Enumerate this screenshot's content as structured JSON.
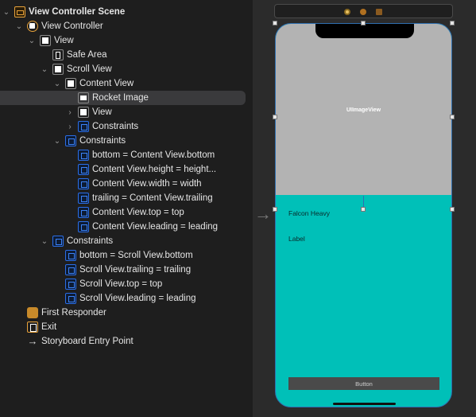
{
  "outline": {
    "items": [
      {
        "label": "View Controller Scene",
        "icon": "scene-icon",
        "expanded": true,
        "level": 0,
        "bold": true
      },
      {
        "label": "View Controller",
        "icon": "view-controller-icon",
        "expanded": true,
        "level": 1
      },
      {
        "label": "View",
        "icon": "view-icon",
        "expanded": true,
        "level": 2
      },
      {
        "label": "Safe Area",
        "icon": "safe-area-icon",
        "level": 3
      },
      {
        "label": "Scroll View",
        "icon": "scroll-view-icon",
        "expanded": true,
        "level": 3
      },
      {
        "label": "Content View",
        "icon": "view-icon",
        "expanded": true,
        "level": 4
      },
      {
        "label": "Rocket Image",
        "icon": "image-view-icon",
        "level": 5,
        "selected": true
      },
      {
        "label": "View",
        "icon": "view-icon",
        "expanded": false,
        "level": 5
      },
      {
        "label": "Constraints",
        "icon": "constraints-icon",
        "expanded": false,
        "level": 5
      },
      {
        "label": "Constraints",
        "icon": "constraints-icon",
        "expanded": true,
        "level": 4
      },
      {
        "label": "bottom = Content View.bottom",
        "icon": "constraint-icon",
        "level": 5
      },
      {
        "label": "Content View.height = height...",
        "icon": "constraint-icon",
        "level": 5
      },
      {
        "label": "Content View.width = width",
        "icon": "constraint-icon",
        "level": 5
      },
      {
        "label": "trailing = Content View.trailing",
        "icon": "constraint-icon",
        "level": 5
      },
      {
        "label": "Content View.top = top",
        "icon": "constraint-icon",
        "level": 5
      },
      {
        "label": "Content View.leading = leading",
        "icon": "constraint-icon",
        "level": 5
      },
      {
        "label": "Constraints",
        "icon": "constraints-icon",
        "expanded": true,
        "level": 3
      },
      {
        "label": "bottom = Scroll View.bottom",
        "icon": "constraint-icon",
        "level": 4
      },
      {
        "label": "Scroll View.trailing = trailing",
        "icon": "constraint-icon",
        "level": 4
      },
      {
        "label": "Scroll View.top = top",
        "icon": "constraint-icon",
        "level": 4
      },
      {
        "label": "Scroll View.leading = leading",
        "icon": "constraint-icon",
        "level": 4
      },
      {
        "label": "First Responder",
        "icon": "first-responder-icon",
        "level": 1
      },
      {
        "label": "Exit",
        "icon": "exit-icon",
        "level": 1
      },
      {
        "label": "Storyboard Entry Point",
        "icon": "entry-arrow-icon",
        "level": 1
      }
    ]
  },
  "canvas": {
    "image_view_label": "UIImageView",
    "title_label": "Falcon Heavy",
    "detail_label": "Label",
    "button_label": "Button",
    "colors": {
      "content_bg": "#00c0b8",
      "image_bg": "#b3b3b3",
      "button_bg": "#4a4a4a",
      "selection_border": "#2f6fb0",
      "accent": "#e8a23a"
    }
  }
}
